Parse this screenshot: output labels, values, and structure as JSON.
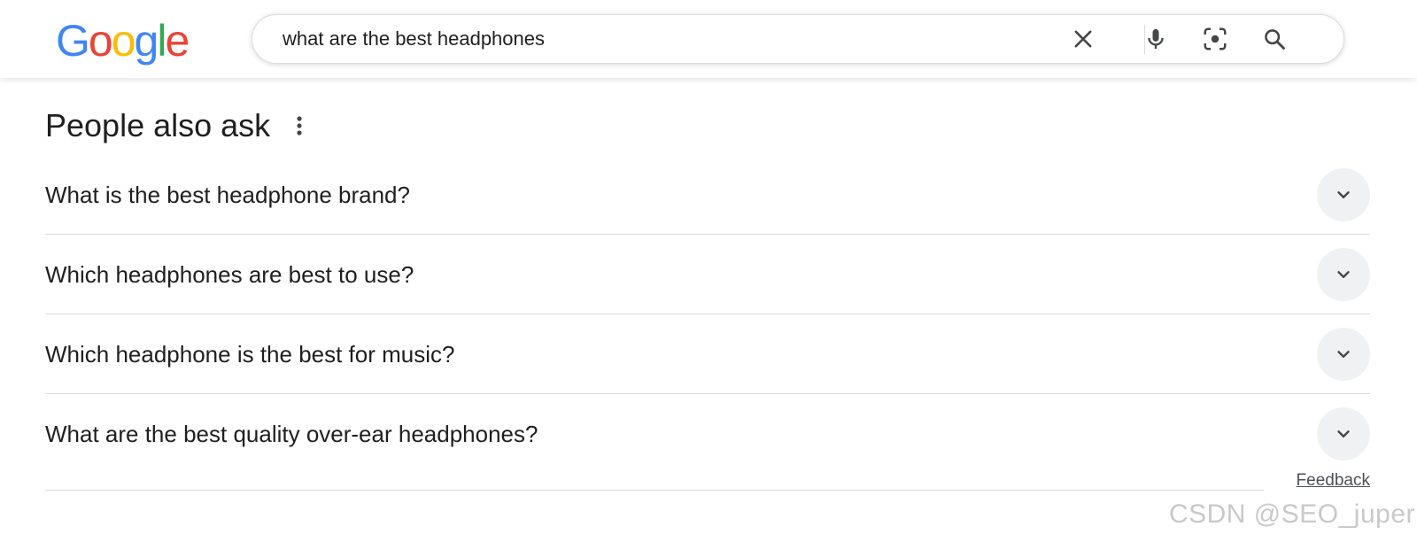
{
  "logo": {
    "letters": [
      "G",
      "o",
      "o",
      "g",
      "l",
      "e"
    ],
    "colors": [
      "#4285F4",
      "#EA4335",
      "#FBBC05",
      "#4285F4",
      "#34A853",
      "#EA4335"
    ]
  },
  "search": {
    "query": "what are the best headphones",
    "icons": [
      "close-icon",
      "microphone-icon",
      "lens-icon",
      "search-icon"
    ]
  },
  "people_also_ask": {
    "title": "People also ask",
    "questions": [
      "What is the best headphone brand?",
      "Which headphones are best to use?",
      "Which headphone is the best for music?",
      "What are the best quality over-ear headphones?"
    ]
  },
  "feedback_label": "Feedback",
  "watermark": "CSDN @SEO_juper",
  "colors": {
    "text": "#1f1f1f",
    "divider": "#dadce0",
    "chevron_bg": "#f0f1f2",
    "icon": "#444746",
    "search_icon": "#4285F4"
  }
}
